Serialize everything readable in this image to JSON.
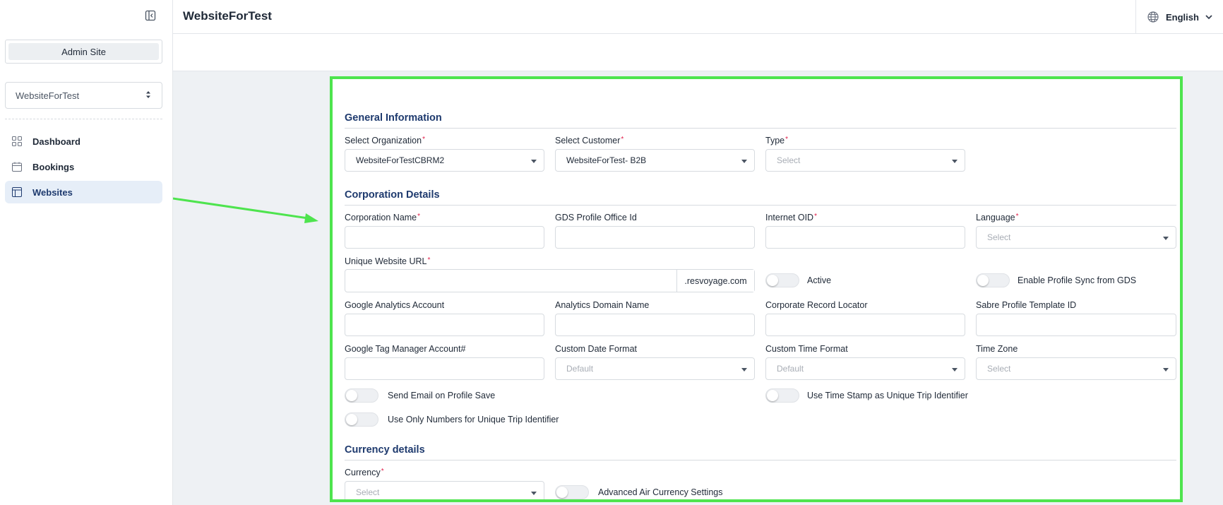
{
  "sidebar": {
    "admin_label": "Admin Site",
    "site_select_value": "WebsiteForTest",
    "nav": [
      {
        "label": "Dashboard",
        "icon": "grid-icon"
      },
      {
        "label": "Bookings",
        "icon": "calendar-icon"
      },
      {
        "label": "Websites",
        "icon": "browser-icon",
        "active": true
      }
    ]
  },
  "header": {
    "title": "WebsiteForTest",
    "language": "English"
  },
  "form": {
    "general": {
      "title": "General Information",
      "organization_label": "Select Organization",
      "organization_value": "WebsiteForTestCBRM2",
      "customer_label": "Select Customer",
      "customer_value": "WebsiteForTest- B2B",
      "type_label": "Type",
      "type_placeholder": "Select"
    },
    "corporation": {
      "title": "Corporation Details",
      "corp_name_label": "Corporation Name",
      "gds_label": "GDS Profile Office Id",
      "internet_oid_label": "Internet OID",
      "language_label": "Language",
      "language_placeholder": "Select",
      "url_label": "Unique Website URL",
      "url_suffix": ".resvoyage.com",
      "active_label": "Active",
      "profile_sync_label": "Enable Profile Sync from GDS",
      "ga_label": "Google Analytics Account",
      "analytics_domain_label": "Analytics Domain Name",
      "record_locator_label": "Corporate Record Locator",
      "sabre_label": "Sabre Profile Template ID",
      "gtm_label": "Google Tag Manager Account#",
      "date_format_label": "Custom Date Format",
      "date_format_placeholder": "Default",
      "time_format_label": "Custom Time Format",
      "time_format_placeholder": "Default",
      "timezone_label": "Time Zone",
      "timezone_placeholder": "Select",
      "send_email_label": "Send Email on Profile Save",
      "timestamp_label": "Use Time Stamp as Unique Trip Identifier",
      "numbers_only_label": "Use Only Numbers for Unique Trip Identifier"
    },
    "currency": {
      "title": "Currency details",
      "currency_label": "Currency",
      "currency_placeholder": "Select",
      "advanced_label": "Advanced Air Currency Settings"
    }
  },
  "colors": {
    "accent": "#1e3a6e",
    "highlight_border": "#4ee44e",
    "required": "#e11d48"
  }
}
